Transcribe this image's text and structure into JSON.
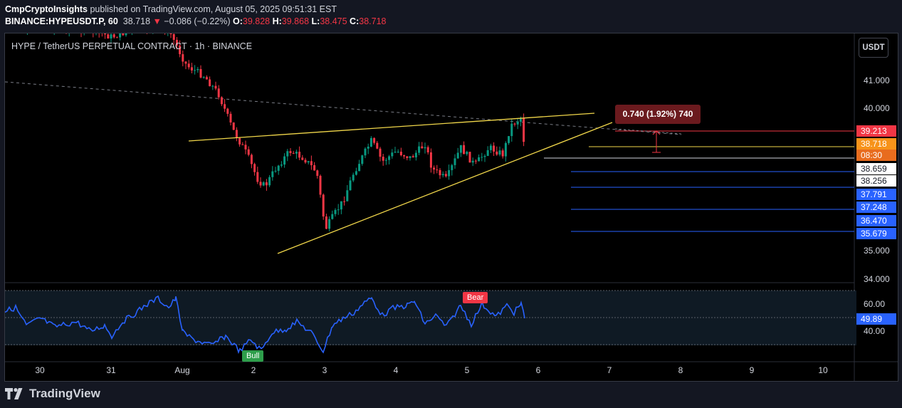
{
  "header": {
    "author": "CmpCryptoInsights",
    "published": " published on TradingView.com, August 05, 2025 09:51:31 EST",
    "symbol": "BINANCE:HYPEUSDT.P, 60",
    "last": "38.718",
    "arrow": "▼",
    "change": "−0.086 (−0.22%)",
    "o_label": "O:",
    "o": "39.828",
    "h_label": "H:",
    "h": "39.868",
    "l_label": "L:",
    "l": "38.475",
    "c_label": "C:",
    "c": "38.718"
  },
  "symbol_line": "HYPE / TetherUS PERPETUAL CONTRACT · 1h · BINANCE",
  "unit_button": "USDT",
  "measure_label": "0.740 (1.92%) 740",
  "y_axis": {
    "ticks": [
      "41.000",
      "40.000",
      "35.000",
      "34.000"
    ],
    "rsi_ticks": [
      "60.00",
      "40.00"
    ]
  },
  "price_tags": [
    {
      "value": "39.213",
      "color": "#f23645"
    },
    {
      "value": "38.718",
      "color": "#f7931a"
    },
    {
      "value": "08:30",
      "color": "#e86c1e"
    },
    {
      "value": "38.659",
      "color": "#ffffff"
    },
    {
      "value": "38.256",
      "color": "#ffffff"
    },
    {
      "value": "37.791",
      "color": "#2962ff"
    },
    {
      "value": "37.248",
      "color": "#2962ff"
    },
    {
      "value": "36.470",
      "color": "#2962ff"
    },
    {
      "value": "35.679",
      "color": "#2962ff"
    }
  ],
  "rsi_tag": "49.89",
  "x_axis": [
    "30",
    "31",
    "Aug",
    "2",
    "3",
    "4",
    "5",
    "6",
    "7",
    "8",
    "9",
    "10"
  ],
  "signals": {
    "bear": "Bear",
    "bull": "Bull"
  },
  "footer": {
    "brand": "TradingView"
  },
  "colors": {
    "up": "#089981",
    "down": "#f23645",
    "trend": "#f0d64a",
    "rsi": "#2962ff",
    "support": "#2962ff"
  }
}
